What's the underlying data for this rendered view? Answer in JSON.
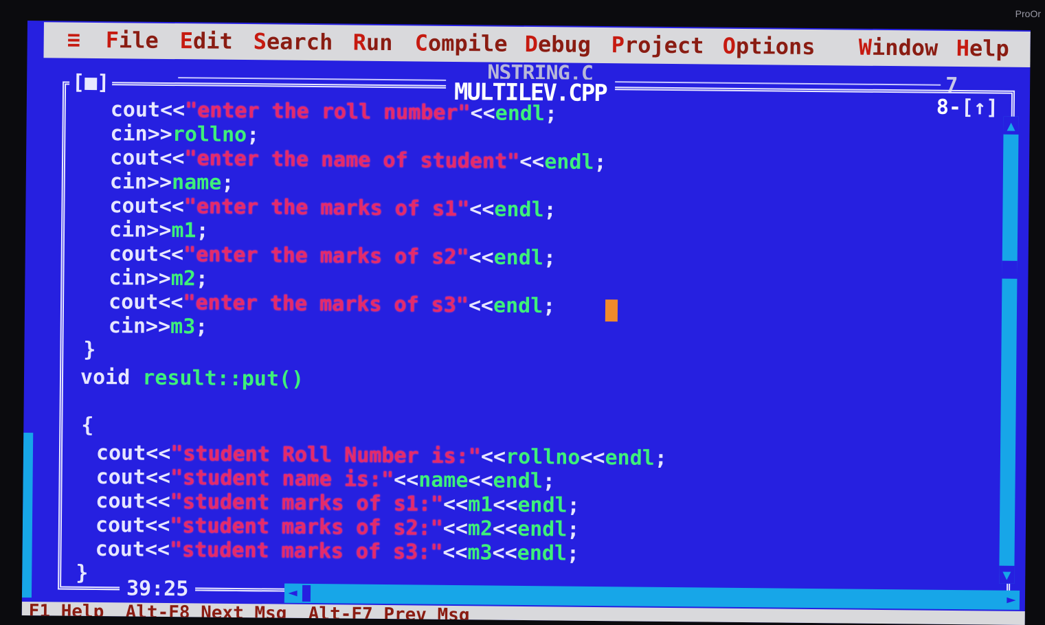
{
  "corner_brand": "ProOr",
  "menu": {
    "system": "≡",
    "items": [
      {
        "hot": "F",
        "rest": "ile"
      },
      {
        "hot": "E",
        "rest": "dit"
      },
      {
        "hot": "S",
        "rest": "earch"
      },
      {
        "hot": "R",
        "rest": "un"
      },
      {
        "hot": "C",
        "rest": "ompile"
      },
      {
        "hot": "D",
        "rest": "ebug"
      },
      {
        "hot": "P",
        "rest": "roject"
      },
      {
        "hot": "O",
        "rest": "ptions"
      },
      {
        "hot": "W",
        "rest": "indow"
      },
      {
        "hot": "H",
        "rest": "elp"
      }
    ]
  },
  "background_window": {
    "title": "NSTRING.C",
    "number": "7"
  },
  "editor_window": {
    "title": "MULTILEV.CPP",
    "close_box": "[■]",
    "number": "8",
    "zoom_box": "[↑]",
    "position": "39:25"
  },
  "code_lines": [
    [
      {
        "t": "kw",
        "v": " cout<<"
      },
      {
        "t": "str",
        "v": "\"enter the roll number\""
      },
      {
        "t": "kw",
        "v": "<<"
      },
      {
        "t": "id",
        "v": "endl"
      },
      {
        "t": "punc",
        "v": ";"
      }
    ],
    [
      {
        "t": "kw",
        "v": " cin>>"
      },
      {
        "t": "id",
        "v": "rollno"
      },
      {
        "t": "punc",
        "v": ";"
      }
    ],
    [
      {
        "t": "kw",
        "v": " cout<<"
      },
      {
        "t": "str",
        "v": "\"enter the name of student\""
      },
      {
        "t": "kw",
        "v": "<<"
      },
      {
        "t": "id",
        "v": "endl"
      },
      {
        "t": "punc",
        "v": ";"
      }
    ],
    [
      {
        "t": "kw",
        "v": " cin>>"
      },
      {
        "t": "id",
        "v": "name"
      },
      {
        "t": "punc",
        "v": ";"
      }
    ],
    [
      {
        "t": "kw",
        "v": " cout<<"
      },
      {
        "t": "str",
        "v": "\"enter the marks of s1\""
      },
      {
        "t": "kw",
        "v": "<<"
      },
      {
        "t": "id",
        "v": "endl"
      },
      {
        "t": "punc",
        "v": ";"
      }
    ],
    [
      {
        "t": "kw",
        "v": " cin>>"
      },
      {
        "t": "id",
        "v": "m1"
      },
      {
        "t": "punc",
        "v": ";"
      }
    ],
    [
      {
        "t": "kw",
        "v": " cout<<"
      },
      {
        "t": "str",
        "v": "\"enter the marks of s2\""
      },
      {
        "t": "kw",
        "v": "<<"
      },
      {
        "t": "id",
        "v": "endl"
      },
      {
        "t": "punc",
        "v": ";"
      }
    ],
    [
      {
        "t": "kw",
        "v": " cin>>"
      },
      {
        "t": "id",
        "v": "m2"
      },
      {
        "t": "punc",
        "v": ";"
      }
    ],
    [
      {
        "t": "kw",
        "v": " cout<<"
      },
      {
        "t": "str",
        "v": "\"enter the marks of s3\""
      },
      {
        "t": "kw",
        "v": "<<"
      },
      {
        "t": "id",
        "v": "endl"
      },
      {
        "t": "punc",
        "v": ";"
      }
    ],
    [
      {
        "t": "kw",
        "v": " cin>>"
      },
      {
        "t": "id",
        "v": "m3"
      },
      {
        "t": "punc",
        "v": ";"
      }
    ],
    [
      {
        "t": "punc",
        "v": "}"
      }
    ],
    [
      {
        "t": "kw",
        "v": "void "
      },
      {
        "t": "id",
        "v": "result::put()"
      }
    ],
    [
      {
        "t": "punc",
        "v": ""
      }
    ],
    [
      {
        "t": "punc",
        "v": "{"
      }
    ],
    [
      {
        "t": "kw",
        "v": " cout<<"
      },
      {
        "t": "str",
        "v": "\"student Roll Number is:\""
      },
      {
        "t": "kw",
        "v": "<<"
      },
      {
        "t": "id",
        "v": "rollno"
      },
      {
        "t": "kw",
        "v": "<<"
      },
      {
        "t": "id",
        "v": "endl"
      },
      {
        "t": "punc",
        "v": ";"
      }
    ],
    [
      {
        "t": "kw",
        "v": " cout<<"
      },
      {
        "t": "str",
        "v": "\"student name is:\""
      },
      {
        "t": "kw",
        "v": "<<"
      },
      {
        "t": "id",
        "v": "name"
      },
      {
        "t": "kw",
        "v": "<<"
      },
      {
        "t": "id",
        "v": "endl"
      },
      {
        "t": "punc",
        "v": ";"
      }
    ],
    [
      {
        "t": "kw",
        "v": " cout<<"
      },
      {
        "t": "str",
        "v": "\"student marks of s1:\""
      },
      {
        "t": "kw",
        "v": "<<"
      },
      {
        "t": "id",
        "v": "m1"
      },
      {
        "t": "kw",
        "v": "<<"
      },
      {
        "t": "id",
        "v": "endl"
      },
      {
        "t": "punc",
        "v": ";"
      }
    ],
    [
      {
        "t": "kw",
        "v": " cout<<"
      },
      {
        "t": "str",
        "v": "\"student marks of s2:\""
      },
      {
        "t": "kw",
        "v": "<<"
      },
      {
        "t": "id",
        "v": "m2"
      },
      {
        "t": "kw",
        "v": "<<"
      },
      {
        "t": "id",
        "v": "endl"
      },
      {
        "t": "punc",
        "v": ";"
      }
    ],
    [
      {
        "t": "kw",
        "v": " cout<<"
      },
      {
        "t": "str",
        "v": "\"student marks of s3:\""
      },
      {
        "t": "kw",
        "v": "<<"
      },
      {
        "t": "id",
        "v": "m3"
      },
      {
        "t": "kw",
        "v": "<<"
      },
      {
        "t": "id",
        "v": "endl"
      },
      {
        "t": "punc",
        "v": ";"
      }
    ],
    [
      {
        "t": "punc",
        "v": "}"
      }
    ]
  ],
  "status_bar": "F1 Help  Alt-F8 Next Msg  Alt-F7 Prev Msg",
  "colors": {
    "desktop": "#2620e0",
    "menu_bg": "#d9d9dc",
    "hotkey": "#c61a10",
    "string": "#e42a6a",
    "identifier": "#3ef07a",
    "keyword": "#e6e6ff",
    "cursor": "#f08a2c",
    "scrollbar": "#17a6e8"
  }
}
